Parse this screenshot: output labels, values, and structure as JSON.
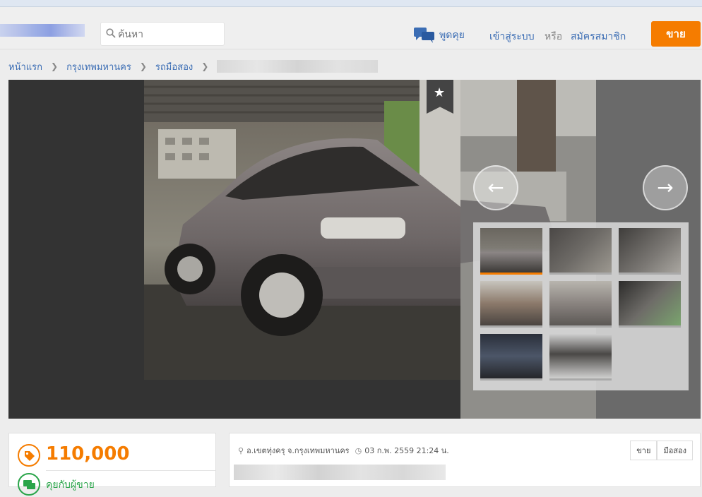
{
  "header": {
    "search_placeholder": "ค้นหา",
    "chat_label": "พูดคุย",
    "login_label": "เข้าสู่ระบบ",
    "or_label": "หรือ",
    "signup_label": "สมัครสมาชิก",
    "sell_button": "ขาย"
  },
  "breadcrumb": {
    "items": [
      "หน้าแรก",
      "กรุงเทพมหานคร",
      "รถมือสอง"
    ]
  },
  "gallery": {
    "thumbnail_count": 8
  },
  "listing": {
    "price": "110,000",
    "chat_with_seller": "คุยกับผู้ขาย",
    "location": "อ.เขตทุ่งครุ จ.กรุงเทพมหานคร",
    "datetime": "03 ก.พ. 2559 21:24 น.",
    "tags": [
      "ขาย",
      "มือสอง"
    ]
  },
  "colors": {
    "accent_orange": "#f57c00",
    "link_blue": "#3b6db4",
    "chat_green": "#2aa54a"
  },
  "icons": [
    "search-icon",
    "chat-bubbles-icon",
    "star-icon",
    "arrow-left-icon",
    "arrow-right-icon",
    "price-tag-icon",
    "chat-icon",
    "location-pin-icon",
    "clock-icon"
  ]
}
